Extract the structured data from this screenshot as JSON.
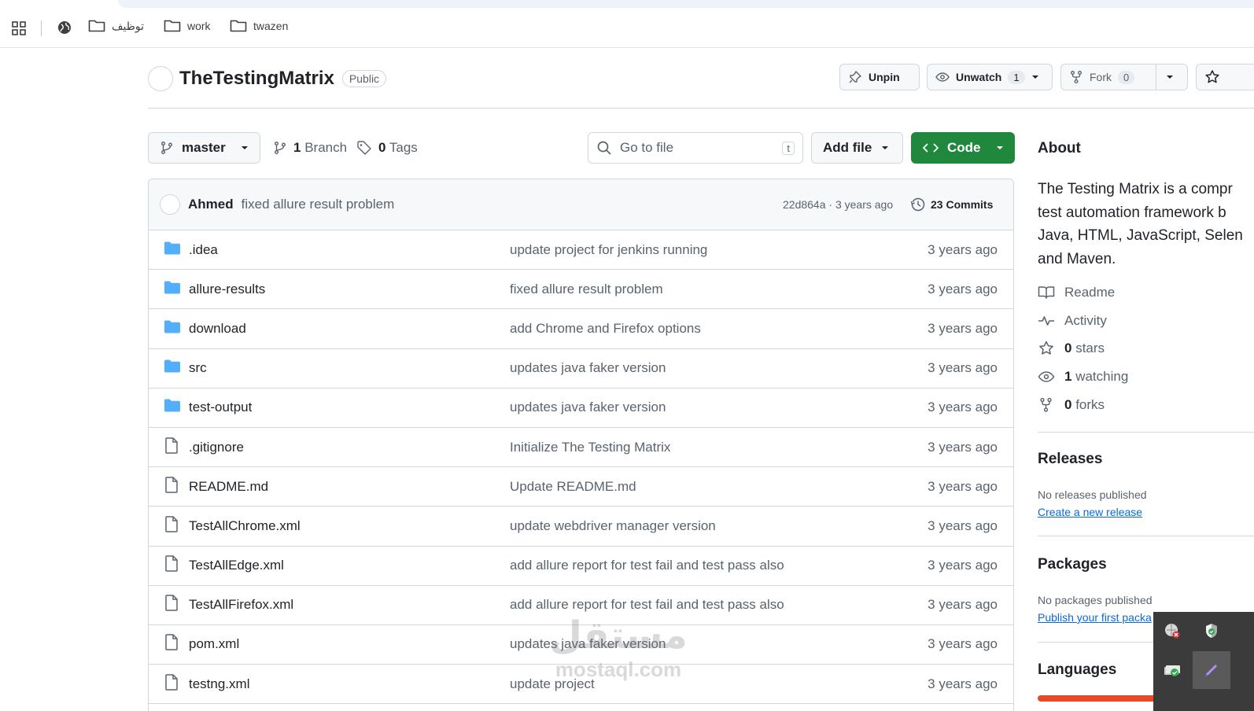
{
  "bookmarks": [
    {
      "label": "توظيف"
    },
    {
      "label": "work"
    },
    {
      "label": "twazen"
    }
  ],
  "repo": {
    "name": "TheTestingMatrix",
    "visibility": "Public",
    "unpin_label": "Unpin",
    "unwatch_label": "Unwatch",
    "watch_count": "1",
    "fork_label": "Fork",
    "fork_count": "0"
  },
  "toolbar": {
    "branch": "master",
    "branch_count": "1",
    "branch_label": "Branch",
    "tag_count": "0",
    "tag_label": "Tags",
    "goto_placeholder": "Go to file",
    "goto_shortcut": "t",
    "add_file_label": "Add file",
    "code_label": "Code"
  },
  "latest_commit": {
    "author": "Ahmed",
    "message": "fixed allure result problem",
    "hash_time": "22d864a · 3 years ago",
    "commits_count": "23",
    "commits_label": "Commits"
  },
  "files": [
    {
      "name": ".idea",
      "type": "folder",
      "message": "update project for jenkins running",
      "age": "3 years ago"
    },
    {
      "name": "allure-results",
      "type": "folder",
      "message": "fixed allure result problem",
      "age": "3 years ago"
    },
    {
      "name": "download",
      "type": "folder",
      "message": "add Chrome and Firefox options",
      "age": "3 years ago"
    },
    {
      "name": "src",
      "type": "folder",
      "message": "updates java faker version",
      "age": "3 years ago"
    },
    {
      "name": "test-output",
      "type": "folder",
      "message": "updates java faker version",
      "age": "3 years ago"
    },
    {
      "name": ".gitignore",
      "type": "file",
      "message": "Initialize The Testing Matrix",
      "age": "3 years ago"
    },
    {
      "name": "README.md",
      "type": "file",
      "message": "Update README.md",
      "age": "3 years ago"
    },
    {
      "name": "TestAllChrome.xml",
      "type": "file",
      "message": "update webdriver manager version",
      "age": "3 years ago"
    },
    {
      "name": "TestAllEdge.xml",
      "type": "file",
      "message": "add allure report for test fail and test pass also",
      "age": "3 years ago"
    },
    {
      "name": "TestAllFirefox.xml",
      "type": "file",
      "message": "add allure report for test fail and test pass also",
      "age": "3 years ago"
    },
    {
      "name": "pom.xml",
      "type": "file",
      "message": "updates java faker version",
      "age": "3 years ago"
    },
    {
      "name": "testng.xml",
      "type": "file",
      "message": "update project",
      "age": "3 years ago"
    }
  ],
  "about": {
    "heading": "About",
    "lines": [
      "The Testing Matrix is a compr",
      "test automation framework b",
      "Java, HTML, JavaScript, Selen",
      "and Maven."
    ],
    "readme": "Readme",
    "activity": "Activity",
    "stars_count": "0",
    "stars_label": "stars",
    "watching_count": "1",
    "watching_label": "watching",
    "forks_count": "0",
    "forks_label": "forks"
  },
  "releases": {
    "heading": "Releases",
    "empty": "No releases published",
    "link": "Create a new release"
  },
  "packages": {
    "heading": "Packages",
    "empty": "No packages published",
    "link": "Publish your first packa"
  },
  "languages": {
    "heading": "Languages"
  },
  "watermark": {
    "arabic": "مستقل",
    "latin": "mostaql.com"
  },
  "colors": {
    "code_button": "#1f883d",
    "folder_icon": "#54aeff",
    "link": "#0969da",
    "language_bar": "#e34c26"
  }
}
